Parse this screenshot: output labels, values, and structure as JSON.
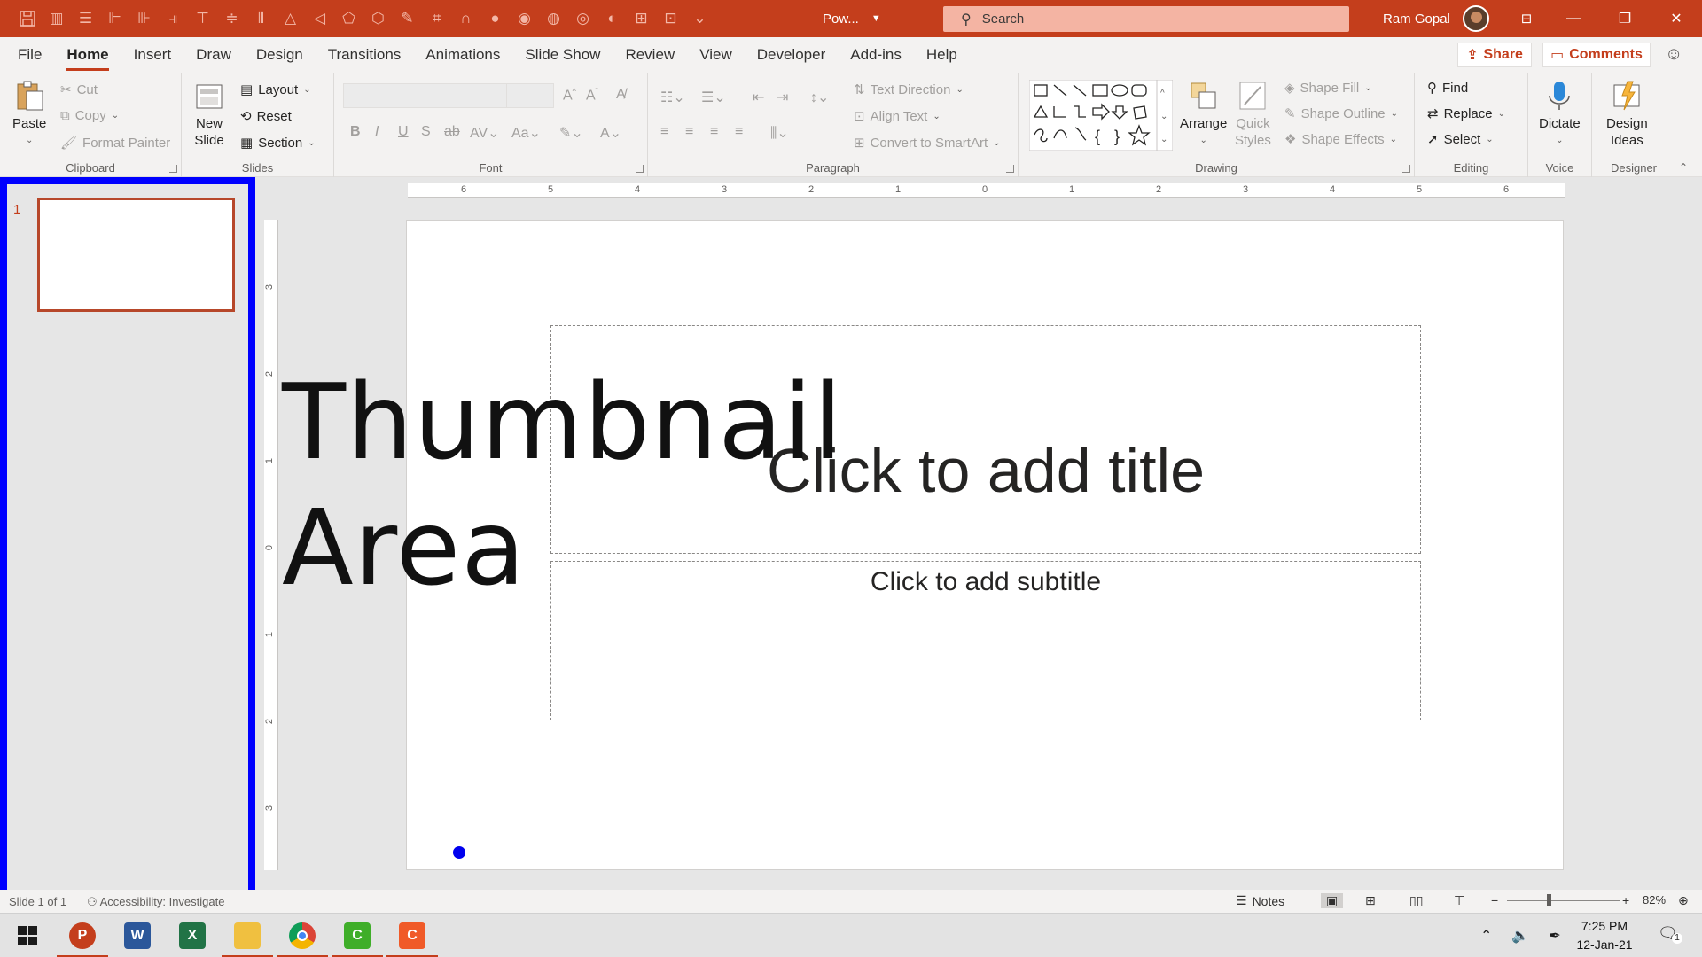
{
  "titlebar": {
    "doc_title": "Pow...",
    "search_placeholder": "Search",
    "user_name": "Ram Gopal"
  },
  "menu": {
    "tabs": [
      "File",
      "Home",
      "Insert",
      "Draw",
      "Design",
      "Transitions",
      "Animations",
      "Slide Show",
      "Review",
      "View",
      "Developer",
      "Add-ins",
      "Help"
    ],
    "share": "Share",
    "comments": "Comments"
  },
  "ribbon": {
    "clipboard": {
      "label": "Clipboard",
      "paste": "Paste",
      "cut": "Cut",
      "copy": "Copy",
      "format_painter": "Format Painter"
    },
    "slides": {
      "label": "Slides",
      "new_slide_1": "New",
      "new_slide_2": "Slide",
      "layout": "Layout",
      "reset": "Reset",
      "section": "Section"
    },
    "font": {
      "label": "Font"
    },
    "paragraph": {
      "label": "Paragraph",
      "text_direction": "Text Direction",
      "align_text": "Align Text",
      "convert_smartart": "Convert to SmartArt"
    },
    "drawing": {
      "label": "Drawing",
      "arrange": "Arrange",
      "quick_styles_1": "Quick",
      "quick_styles_2": "Styles",
      "shape_fill": "Shape Fill",
      "shape_outline": "Shape Outline",
      "shape_effects": "Shape Effects"
    },
    "editing": {
      "label": "Editing",
      "find": "Find",
      "replace": "Replace",
      "select": "Select"
    },
    "voice": {
      "label": "Voice",
      "dictate": "Dictate"
    },
    "designer": {
      "label": "Designer",
      "design_ideas_1": "Design",
      "design_ideas_2": "Ideas"
    }
  },
  "thumbnail": {
    "slide_number": "1"
  },
  "ruler": {
    "h_labels": [
      "6",
      "5",
      "4",
      "3",
      "2",
      "1",
      "0",
      "1",
      "2",
      "3",
      "4",
      "5",
      "6"
    ],
    "v_labels": [
      "3",
      "2",
      "1",
      "0",
      "1",
      "2",
      "3"
    ]
  },
  "slide": {
    "title_placeholder": "Click to add title",
    "subtitle_placeholder": "Click to add subtitle"
  },
  "overlay": {
    "line1": "Thumbnail",
    "line2": "Area"
  },
  "status": {
    "slide_info": "Slide 1 of 1",
    "accessibility": "Accessibility: Investigate",
    "notes": "Notes",
    "zoom": "82%"
  },
  "taskbar": {
    "time": "7:25 PM",
    "date": "12-Jan-21",
    "notification_count": "1"
  },
  "colors": {
    "accent": "#c43e1c",
    "highlight_border": "#0000ff"
  }
}
